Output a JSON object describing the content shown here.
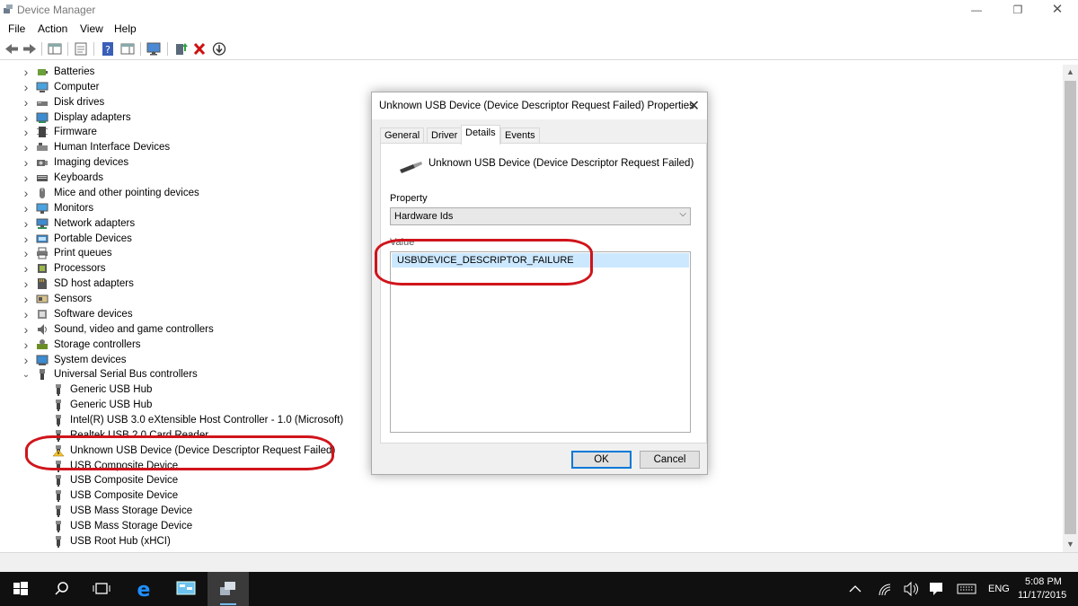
{
  "window": {
    "title": "Device Manager",
    "menu": [
      "File",
      "Action",
      "View",
      "Help"
    ]
  },
  "tree": {
    "categories": [
      {
        "label": "Batteries",
        "icon": "battery-icon"
      },
      {
        "label": "Computer",
        "icon": "computer-icon"
      },
      {
        "label": "Disk drives",
        "icon": "disk-drive-icon"
      },
      {
        "label": "Display adapters",
        "icon": "display-adapter-icon"
      },
      {
        "label": "Firmware",
        "icon": "firmware-icon"
      },
      {
        "label": "Human Interface Devices",
        "icon": "hid-icon"
      },
      {
        "label": "Imaging devices",
        "icon": "camera-icon"
      },
      {
        "label": "Keyboards",
        "icon": "keyboard-icon"
      },
      {
        "label": "Mice and other pointing devices",
        "icon": "mouse-icon"
      },
      {
        "label": "Monitors",
        "icon": "monitor-icon"
      },
      {
        "label": "Network adapters",
        "icon": "network-adapter-icon"
      },
      {
        "label": "Portable Devices",
        "icon": "portable-device-icon"
      },
      {
        "label": "Print queues",
        "icon": "printer-icon"
      },
      {
        "label": "Processors",
        "icon": "processor-icon"
      },
      {
        "label": "SD host adapters",
        "icon": "sd-card-icon"
      },
      {
        "label": "Sensors",
        "icon": "sensor-icon"
      },
      {
        "label": "Software devices",
        "icon": "software-device-icon"
      },
      {
        "label": "Sound, video and game controllers",
        "icon": "speaker-icon"
      },
      {
        "label": "Storage controllers",
        "icon": "storage-controller-icon"
      },
      {
        "label": "System devices",
        "icon": "system-device-icon"
      },
      {
        "label": "Universal Serial Bus controllers",
        "icon": "usb-icon"
      }
    ],
    "usb_children": [
      {
        "label": "Generic USB Hub",
        "warning": false
      },
      {
        "label": "Generic USB Hub",
        "warning": false
      },
      {
        "label": "Intel(R) USB 3.0 eXtensible Host Controller - 1.0 (Microsoft)",
        "warning": false
      },
      {
        "label": "Realtek USB 2.0 Card Reader",
        "warning": false
      },
      {
        "label": "Unknown USB Device (Device Descriptor Request Failed)",
        "warning": true
      },
      {
        "label": "USB Composite Device",
        "warning": false
      },
      {
        "label": "USB Composite Device",
        "warning": false
      },
      {
        "label": "USB Composite Device",
        "warning": false
      },
      {
        "label": "USB Mass Storage Device",
        "warning": false
      },
      {
        "label": "USB Mass Storage Device",
        "warning": false
      },
      {
        "label": "USB Root Hub (xHCI)",
        "warning": false
      }
    ]
  },
  "dialog": {
    "title": "Unknown USB Device (Device Descriptor Request Failed) Properties",
    "tabs": [
      "General",
      "Driver",
      "Details",
      "Events"
    ],
    "active_tab": "Details",
    "device_name": "Unknown USB Device (Device Descriptor Request Failed)",
    "property_label": "Property",
    "property_value": "Hardware Ids",
    "value_label": "Value",
    "value_items": [
      "USB\\DEVICE_DESCRIPTOR_FAILURE"
    ],
    "ok_label": "OK",
    "cancel_label": "Cancel"
  },
  "taskbar": {
    "language": "ENG",
    "time": "5:08 PM",
    "date": "11/17/2015"
  },
  "colors": {
    "annotation": "#d0141b",
    "selection": "#cce8ff",
    "accent": "#0078d7"
  }
}
